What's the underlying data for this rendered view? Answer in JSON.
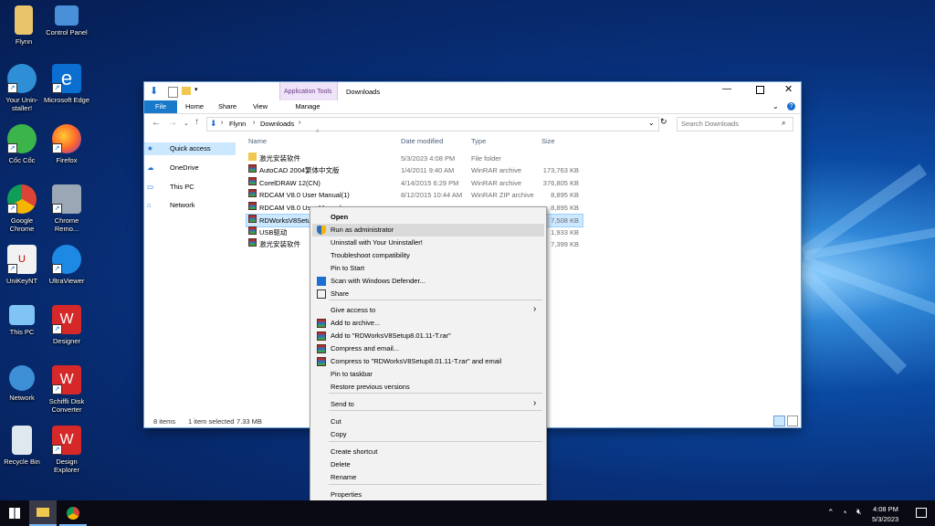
{
  "desktop": {
    "icons": [
      {
        "label": "Flynn",
        "icon": "user-folder-icon"
      },
      {
        "label": "Control Panel",
        "icon": "control-panel-icon"
      },
      {
        "label": "Your Unin-staller!",
        "icon": "uninstaller-icon"
      },
      {
        "label": "Microsoft Edge",
        "icon": "edge-icon"
      },
      {
        "label": "Cốc Cốc",
        "icon": "coccoc-icon"
      },
      {
        "label": "Firefox",
        "icon": "firefox-icon"
      },
      {
        "label": "Google Chrome",
        "icon": "chrome-icon"
      },
      {
        "label": "Chrome Remo...",
        "icon": "chrome-remote-icon"
      },
      {
        "label": "UniKeyNT",
        "icon": "unikey-icon"
      },
      {
        "label": "UltraViewer",
        "icon": "ultraviewer-icon"
      },
      {
        "label": "This PC",
        "icon": "this-pc-icon"
      },
      {
        "label": "Designer",
        "icon": "designer-icon"
      },
      {
        "label": "Network",
        "icon": "network-icon"
      },
      {
        "label": "Schiffli Disk Converter",
        "icon": "schiffli-icon"
      },
      {
        "label": "Recycle Bin",
        "icon": "recycle-bin-icon"
      },
      {
        "label": "Design Explorer",
        "icon": "design-explorer-icon"
      }
    ]
  },
  "explorer": {
    "title": "Downloads",
    "context_tab": "Application Tools",
    "tabs": [
      "File",
      "Home",
      "Share",
      "View",
      "Manage"
    ],
    "breadcrumb": [
      "Flynn",
      "Downloads"
    ],
    "search_placeholder": "Search Downloads",
    "nav": [
      "Quick access",
      "OneDrive",
      "This PC",
      "Network"
    ],
    "columns": {
      "name": "Name",
      "date": "Date modified",
      "type": "Type",
      "size": "Size"
    },
    "files": [
      {
        "name": "激光安装软件",
        "date": "5/3/2023 4:08 PM",
        "type": "File folder",
        "size": "",
        "icon": "folder-icon"
      },
      {
        "name": "AutoCAD 2004繁体中文版",
        "date": "1/4/2011 9:40 AM",
        "type": "WinRAR archive",
        "size": "173,763 KB",
        "icon": "winrar-icon"
      },
      {
        "name": "CorelDRAW 12(CN)",
        "date": "4/14/2015 6:29 PM",
        "type": "WinRAR archive",
        "size": "376,805 KB",
        "icon": "winrar-icon"
      },
      {
        "name": "RDCAM V8.0 User Manual(1)",
        "date": "8/12/2015 10:44 AM",
        "type": "WinRAR ZIP archive",
        "size": "8,895 KB",
        "icon": "winrar-icon"
      },
      {
        "name": "RDCAM V8.0 User Manual",
        "date": "",
        "type": "",
        "size": "8,895 KB",
        "icon": "winrar-icon"
      },
      {
        "name": "RDWorksV8Setup",
        "date": "",
        "type": "",
        "size": "7,508 KB",
        "icon": "winrar-icon"
      },
      {
        "name": "USB驱动",
        "date": "",
        "type": "",
        "size": "1,933 KB",
        "icon": "winrar-icon"
      },
      {
        "name": "激光安装软件",
        "date": "",
        "type": "",
        "size": "7,399 KB",
        "icon": "winrar-icon"
      }
    ],
    "status": {
      "count": "8 items",
      "selected": "1 item selected",
      "size": "7.33 MB"
    }
  },
  "context_menu": {
    "items": [
      {
        "label": "Open",
        "bold": true,
        "icon": ""
      },
      {
        "label": "Run as administrator",
        "icon": "shield-icon"
      },
      {
        "label": "Uninstall with Your Uninstaller!",
        "icon": ""
      },
      {
        "label": "Troubleshoot compatibility",
        "icon": ""
      },
      {
        "label": "Pin to Start",
        "icon": ""
      },
      {
        "label": "Scan with Windows Defender...",
        "icon": "defender-icon"
      },
      {
        "label": "Share",
        "icon": "share-icon"
      },
      {
        "label": "Give access to",
        "icon": "",
        "submenu": true
      },
      {
        "label": "Add to archive...",
        "icon": "winrar-icon"
      },
      {
        "label": "Add to \"RDWorksV8Setup8.01.11-T.rar\"",
        "icon": "winrar-icon"
      },
      {
        "label": "Compress and email...",
        "icon": "winrar-icon"
      },
      {
        "label": "Compress to \"RDWorksV8Setup8.01.11-T.rar\" and email",
        "icon": "winrar-icon"
      },
      {
        "label": "Pin to taskbar",
        "icon": ""
      },
      {
        "label": "Restore previous versions",
        "icon": ""
      },
      {
        "label": "Send to",
        "icon": "",
        "submenu": true
      },
      {
        "label": "Cut",
        "icon": ""
      },
      {
        "label": "Copy",
        "icon": ""
      },
      {
        "label": "Create shortcut",
        "icon": ""
      },
      {
        "label": "Delete",
        "icon": ""
      },
      {
        "label": "Rename",
        "icon": ""
      },
      {
        "label": "Properties",
        "icon": ""
      }
    ]
  },
  "taskbar": {
    "time": "4:08 PM",
    "date": "5/3/2023",
    "apps": [
      "file-explorer-icon",
      "chrome-icon"
    ]
  }
}
